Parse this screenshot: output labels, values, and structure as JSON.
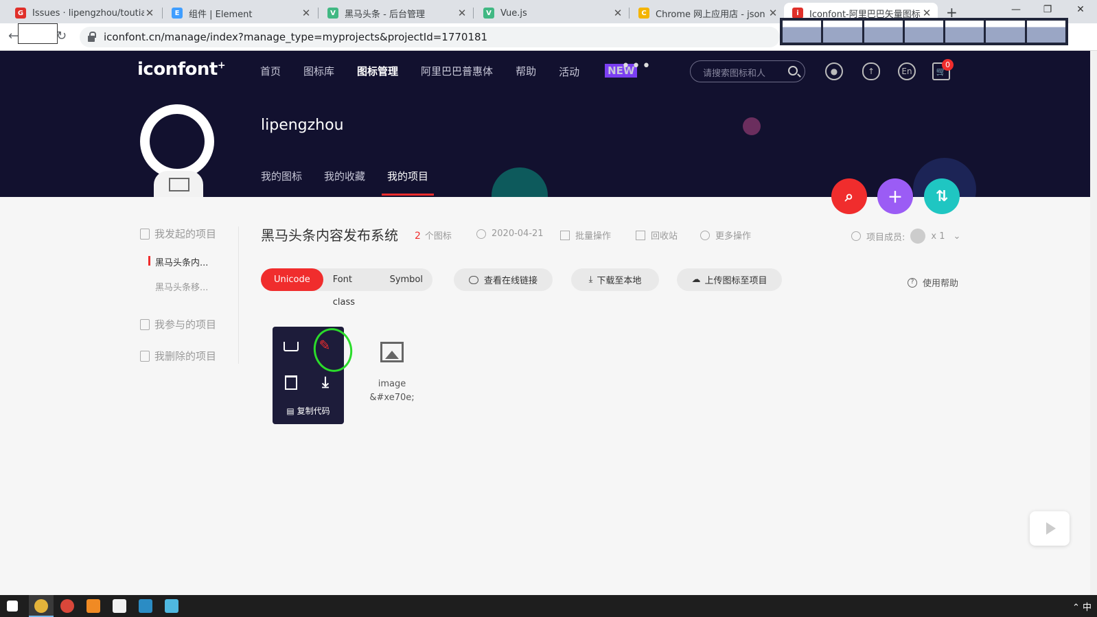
{
  "browser": {
    "tabs": [
      {
        "title": "Issues · lipengzhou/toutiao",
        "favicon": "G",
        "favicon_color": "#e0302a"
      },
      {
        "title": "组件 | Element",
        "favicon": "E",
        "favicon_color": "#409eff"
      },
      {
        "title": "黑马头条 - 后台管理",
        "favicon": "V",
        "favicon_color": "#41b883"
      },
      {
        "title": "Vue.js",
        "favicon": "V",
        "favicon_color": "#41b883"
      },
      {
        "title": "Chrome 网上应用店 - json",
        "favicon": "C",
        "favicon_color": "#f4b400"
      },
      {
        "title": "Iconfont-阿里巴巴矢量图标",
        "favicon": "i",
        "favicon_color": "#e0302a"
      }
    ],
    "url": "iconfont.cn/manage/index?manage_type=myprojects&projectId=1770181"
  },
  "header": {
    "logo": "iconfont",
    "logo_mark": "+",
    "nav": [
      "首页",
      "图标库",
      "图标管理",
      "阿里巴巴普惠体",
      "帮助",
      "活动"
    ],
    "new_badge": "NEW",
    "more": "•••",
    "search_placeholder": "请搜索图标和人",
    "lang_icon": "En",
    "cart_count": "0"
  },
  "profile": {
    "username": "lipengzhou",
    "tabs": [
      "我的图标",
      "我的收藏",
      "我的项目"
    ]
  },
  "sidebar": {
    "started": "我发起的项目",
    "projects": [
      "黑马头条内...",
      "黑马头条移..."
    ],
    "joined": "我参与的项目",
    "deleted": "我删除的项目"
  },
  "project": {
    "title": "黑马头条内容发布系统",
    "icon_count": "2",
    "icon_count_unit": "个图标",
    "date": "2020-04-21",
    "batch": "批量操作",
    "recycle": "回收站",
    "more_ops": "更多操作",
    "members_label": "项目成员:",
    "members_count": "x 1"
  },
  "toolbar": {
    "modes": [
      "Unicode",
      "Font class",
      "Symbol"
    ],
    "view_link": "查看在线链接",
    "download": "下载至本地",
    "upload": "上传图标至项目",
    "help": "使用帮助"
  },
  "icons": [
    {
      "copy_label": "复制代码"
    },
    {
      "name": "image",
      "code": "&#xe70e;"
    }
  ],
  "colors": {
    "accent": "#f02d2d",
    "header_bg": "#12112f",
    "fab_purple": "#9b5cf5",
    "fab_teal": "#1fc6c2"
  }
}
